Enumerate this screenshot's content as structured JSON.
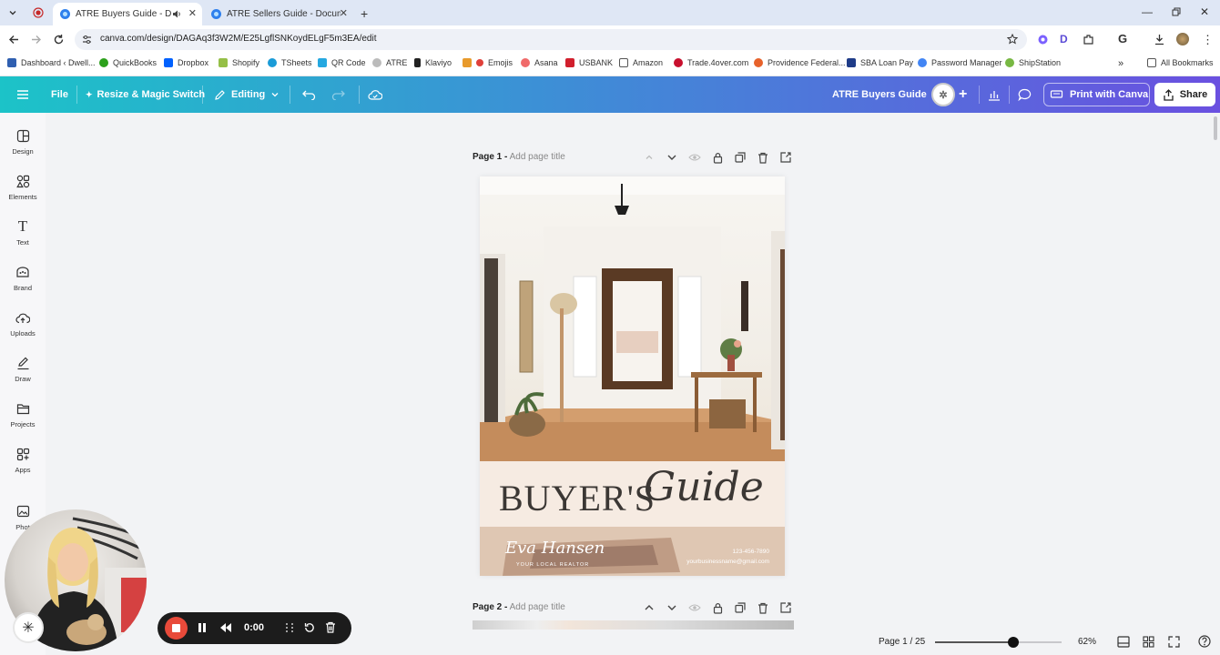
{
  "browser": {
    "tabs": [
      {
        "title": "ATRE Buyers Guide - Document",
        "active": true
      },
      {
        "title": "ATRE Sellers Guide - Document",
        "active": false
      }
    ],
    "url": "canva.com/design/DAGAq3f3W2M/E25LgflSNKoydELgF5m3EA/edit",
    "bookmarks": [
      {
        "label": "Dashboard ‹ Dwell...",
        "color": "#2f5fb0"
      },
      {
        "label": "QuickBooks",
        "color": "#2ca01c"
      },
      {
        "label": "Dropbox",
        "color": "#0061fe"
      },
      {
        "label": "Shopify",
        "color": "#95bf47"
      },
      {
        "label": "TSheets",
        "color": "#1a9bd7"
      },
      {
        "label": "QR Code",
        "color": "#25a8e0"
      },
      {
        "label": "ATRE",
        "color": "#bbbbbb"
      },
      {
        "label": "Klaviyo",
        "color": "#222222"
      },
      {
        "label": "Emojis",
        "color": "#e0403a"
      },
      {
        "label": "Asana",
        "color": "#f06a6a"
      },
      {
        "label": "USBANK",
        "color": "#d11f2d"
      },
      {
        "label": "Amazon",
        "color": "#555555"
      },
      {
        "label": "Trade.4over.com",
        "color": "#c8102e"
      },
      {
        "label": "Providence Federal...",
        "color": "#e7622b"
      },
      {
        "label": "SBA Loan Pay",
        "color": "#1f3c88"
      },
      {
        "label": "Password Manager",
        "color": "#4285f4"
      },
      {
        "label": "ShipStation",
        "color": "#78b843"
      }
    ],
    "all_bookmarks": "All Bookmarks"
  },
  "canva": {
    "file": "File",
    "resize": "Resize & Magic Switch",
    "editing": "Editing",
    "doc_title": "ATRE Buyers Guide",
    "print": "Print with Canva",
    "share": "Share"
  },
  "rail": [
    {
      "label": "Design",
      "icon": "design-icon"
    },
    {
      "label": "Elements",
      "icon": "elements-icon"
    },
    {
      "label": "Text",
      "icon": "text-icon"
    },
    {
      "label": "Brand",
      "icon": "brand-icon"
    },
    {
      "label": "Uploads",
      "icon": "uploads-icon"
    },
    {
      "label": "Draw",
      "icon": "draw-icon"
    },
    {
      "label": "Projects",
      "icon": "projects-icon"
    },
    {
      "label": "Apps",
      "icon": "apps-icon"
    },
    {
      "label": "Phot",
      "icon": "photos-icon"
    }
  ],
  "pages": [
    {
      "label": "Page 1 -",
      "title_placeholder": "Add page title"
    },
    {
      "label": "Page 2 -",
      "title_placeholder": "Add page title"
    }
  ],
  "design": {
    "headline_main": "BUYER'S",
    "headline_script": "Guide",
    "signature": "Eva Hansen",
    "tagline": "YOUR LOCAL REALTOR",
    "phone": "123-456-7890",
    "email": "yourbusinessname@gmail.com"
  },
  "footer": {
    "page_count": "Page 1 / 25",
    "zoom": "62%",
    "zoom_level": 0.62
  },
  "recorder": {
    "time": "0:00"
  }
}
